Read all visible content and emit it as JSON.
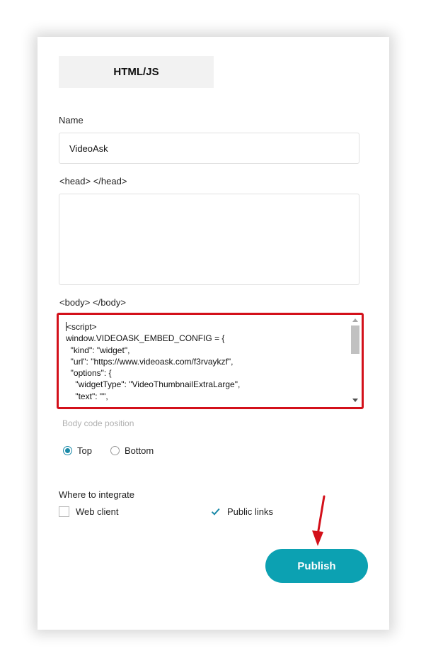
{
  "tab": {
    "label": "HTML/JS"
  },
  "name": {
    "label": "Name",
    "value": "VideoAsk"
  },
  "head": {
    "label": "<head> </head>",
    "value": ""
  },
  "body": {
    "label": "<body> </body>",
    "code_lines": [
      "<script>",
      "window.VIDEOASK_EMBED_CONFIG = {",
      "  \"kind\": \"widget\",",
      "  \"url\": \"https://www.videoask.com/f3rvaykzf\",",
      "  \"options\": {",
      "    \"widgetType\": \"VideoThumbnailExtraLarge\",",
      "    \"text\": \"\","
    ]
  },
  "position": {
    "hint": "Body code position",
    "options": [
      {
        "label": "Top",
        "selected": true
      },
      {
        "label": "Bottom",
        "selected": false
      }
    ]
  },
  "integrate": {
    "label": "Where to integrate",
    "options": [
      {
        "label": "Web client",
        "checked": false
      },
      {
        "label": "Public links",
        "checked": true
      }
    ]
  },
  "publish": {
    "label": "Publish"
  },
  "colors": {
    "accent": "#0ca1b2",
    "highlight": "#d3101a"
  }
}
